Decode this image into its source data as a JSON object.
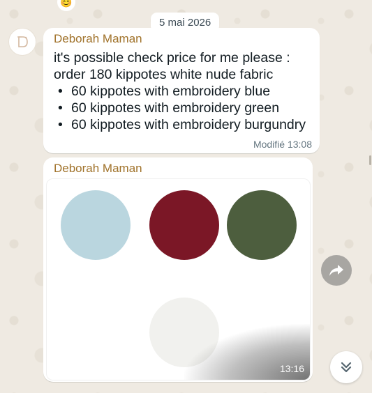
{
  "chat": {
    "date_chip": "5 mai 2026",
    "top_emoji": "😊"
  },
  "messages": [
    {
      "sender": "Deborah Maman",
      "intro": "it's possible check price for me please : order 180 kippotes white nude fabric",
      "items": [
        "60 kippotes with embroidery blue",
        "60 kippotes with embroidery green",
        "60 kippotes with embroidery burgundry"
      ],
      "meta": "Modifié 13:08"
    },
    {
      "sender": "Deborah Maman",
      "time": "13:16",
      "swatches": [
        {
          "name": "blue",
          "color": "#bad6df"
        },
        {
          "name": "burgundy",
          "color": "#7b1726"
        },
        {
          "name": "green",
          "color": "#4d5e3e"
        },
        {
          "name": "white",
          "color": "#f1f1ee"
        }
      ]
    }
  ],
  "colors": {
    "sender": "#a0722a",
    "background": "#efeae2"
  },
  "icons": {
    "forward": "forward-arrow-icon",
    "scroll_down": "double-chevron-down-icon"
  }
}
